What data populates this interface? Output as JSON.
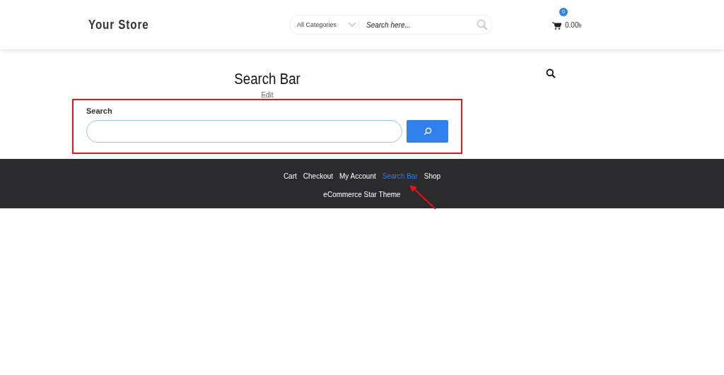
{
  "header": {
    "logo": "Your Store",
    "category_select": "All Categories",
    "search": {
      "placeholder": "Search here..."
    },
    "cart": {
      "count": "0",
      "total": "0.00৳"
    }
  },
  "page": {
    "title": "Search Bar",
    "edit_link": "Edit"
  },
  "search_widget": {
    "label": "Search",
    "highlighted": true
  },
  "footer": {
    "links": [
      {
        "label": "Cart",
        "selected": false
      },
      {
        "label": "Checkout",
        "selected": false
      },
      {
        "label": "My Account",
        "selected": false
      },
      {
        "label": "Search Bar",
        "selected": true
      },
      {
        "label": "Shop",
        "selected": false
      }
    ],
    "credit": "eCommerce Star Theme"
  }
}
